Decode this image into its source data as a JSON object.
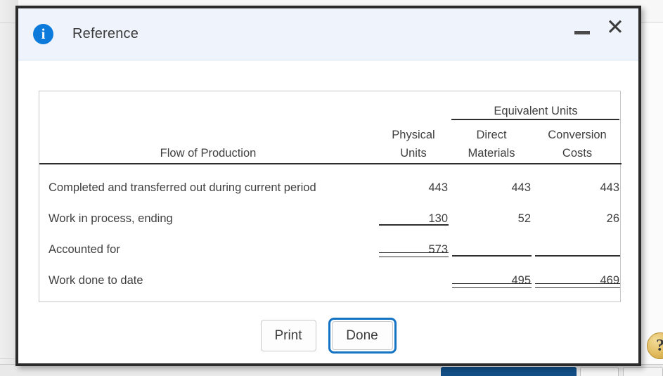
{
  "dialog": {
    "title": "Reference",
    "info_icon": "info-icon",
    "minimize_label": "Minimize",
    "close_label": "Close",
    "close_glyph": "✕"
  },
  "table": {
    "group_header": "Equivalent Units",
    "columns": {
      "label_line": "Flow of Production",
      "physical_line1": "Physical",
      "physical_line2": "Units",
      "dm_line1": "Direct",
      "dm_line2": "Materials",
      "cc_line1": "Conversion",
      "cc_line2": "Costs"
    },
    "rows": [
      {
        "label": "Completed and transferred out during current period",
        "physical": "443",
        "direct_materials": "443",
        "conversion_costs": "443"
      },
      {
        "label": "Work in process, ending",
        "physical": "130",
        "direct_materials": "52",
        "conversion_costs": "26"
      },
      {
        "label": "Accounted for",
        "physical": "573",
        "direct_materials": "",
        "conversion_costs": ""
      },
      {
        "label": "Work done to date",
        "physical": "",
        "direct_materials": "495",
        "conversion_costs": "469"
      }
    ]
  },
  "footer": {
    "print_label": "Print",
    "done_label": "Done"
  },
  "background": {
    "help_badge_glyph": "?"
  },
  "colors": {
    "titlebar_bg": "#eef3fc",
    "info_blue": "#0b7ada",
    "focus_blue": "#1573c4",
    "dialog_border": "#2b2b2b",
    "text": "#3f3f3f",
    "rule": "#2e2e2e",
    "bg_blue_button": "#134f86",
    "help_badge": "#e2bb5e"
  }
}
